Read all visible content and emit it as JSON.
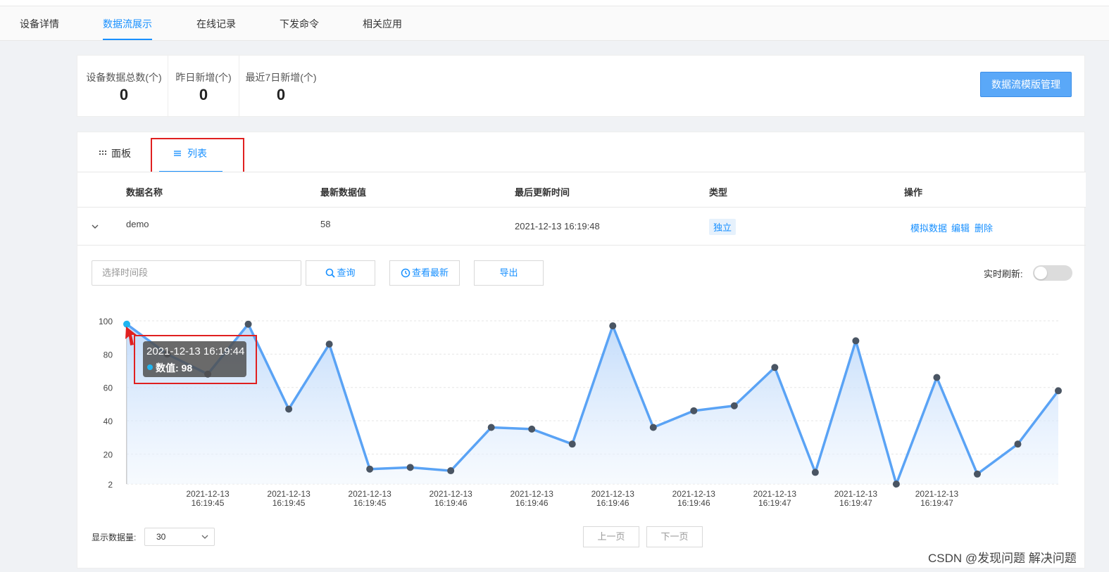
{
  "top_tabs": [
    "设备详情",
    "数据流展示",
    "在线记录",
    "下发命令",
    "相关应用"
  ],
  "stats": {
    "total_label": "设备数据总数(个)",
    "total_value": "0",
    "yesterday_label": "昨日新增(个)",
    "yesterday_value": "0",
    "week_label": "最近7日新增(个)",
    "week_value": "0",
    "template_button": "数据流模版管理"
  },
  "view_tabs": {
    "panel": "面板",
    "list": "列表"
  },
  "table": {
    "headers": [
      "数据名称",
      "最新数据值",
      "最后更新时间",
      "类型",
      "操作"
    ],
    "row": {
      "name": "demo",
      "value": "58",
      "time": "2021-12-13 16:19:48",
      "type": "独立",
      "ops": [
        "模拟数据",
        "编辑",
        "删除"
      ]
    }
  },
  "filter": {
    "placeholder": "选择时间段",
    "query": "查询",
    "latest": "查看最新",
    "export": "导出",
    "realtime_label": "实时刷新:"
  },
  "tooltip": {
    "time": "2021-12-13 16:19:44",
    "value_text": "数值: 98"
  },
  "pagination": {
    "size_label": "显示数据量:",
    "size_value": "30",
    "prev": "上一页",
    "next": "下一页"
  },
  "watermark": "CSDN @发现问题 解决问题",
  "colors": {
    "accent": "#1890ff",
    "line": "#5aa3f5",
    "point": "#4a5563",
    "highlight_point": "#1fb5f0",
    "annotation": "#e02020"
  },
  "chart_data": {
    "type": "area",
    "y_ticks": [
      "100",
      "80",
      "60",
      "40",
      "20",
      "2"
    ],
    "ylim": [
      2,
      100
    ],
    "values": [
      98,
      80,
      68,
      98,
      47,
      86,
      11,
      12,
      10,
      36,
      35,
      26,
      97,
      36,
      46,
      49,
      72,
      9,
      88,
      2,
      66,
      8,
      26,
      58
    ],
    "x_tick_labels": [
      [
        "2021-12-13",
        "16:19:45"
      ],
      [
        "2021-12-13",
        "16:19:45"
      ],
      [
        "2021-12-13",
        "16:19:45"
      ],
      [
        "2021-12-13",
        "16:19:46"
      ],
      [
        "2021-12-13",
        "16:19:46"
      ],
      [
        "2021-12-13",
        "16:19:46"
      ],
      [
        "2021-12-13",
        "16:19:46"
      ],
      [
        "2021-12-13",
        "16:19:47"
      ],
      [
        "2021-12-13",
        "16:19:47"
      ],
      [
        "2021-12-13",
        "16:19:47"
      ]
    ],
    "highlight_index": 0,
    "grid": true
  }
}
